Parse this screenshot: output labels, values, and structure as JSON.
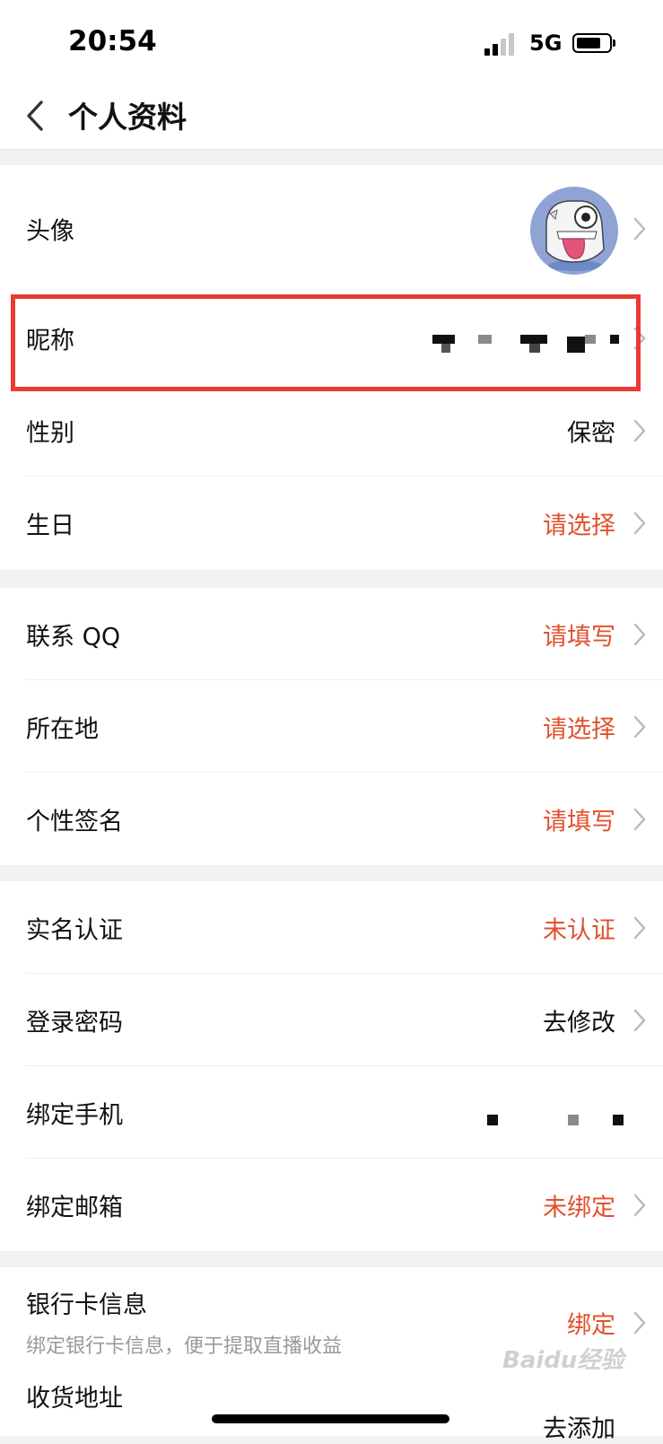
{
  "status_bar": {
    "time": "20:54",
    "network": "5G"
  },
  "header": {
    "title": "个人资料"
  },
  "rows": {
    "avatar": {
      "label": "头像"
    },
    "nickname": {
      "label": "昵称"
    },
    "gender": {
      "label": "性别",
      "value": "保密"
    },
    "birthday": {
      "label": "生日",
      "value": "请选择"
    },
    "qq": {
      "label": "联系 QQ",
      "value": "请填写"
    },
    "location": {
      "label": "所在地",
      "value": "请选择"
    },
    "signature": {
      "label": "个性签名",
      "value": "请填写"
    },
    "real_name": {
      "label": "实名认证",
      "value": "未认证"
    },
    "password": {
      "label": "登录密码",
      "value": "去修改"
    },
    "phone": {
      "label": "绑定手机"
    },
    "email": {
      "label": "绑定邮箱",
      "value": "未绑定"
    },
    "bank": {
      "label": "银行卡信息",
      "subtitle": "绑定银行卡信息，便于提取直播收益",
      "value": "绑定"
    },
    "address": {
      "label": "收货地址",
      "value": "去添加"
    }
  },
  "watermark": "Baidu经验",
  "colors": {
    "accent": "#e0512e",
    "highlight": "#ea3a32",
    "background": "#f2f2f4"
  }
}
